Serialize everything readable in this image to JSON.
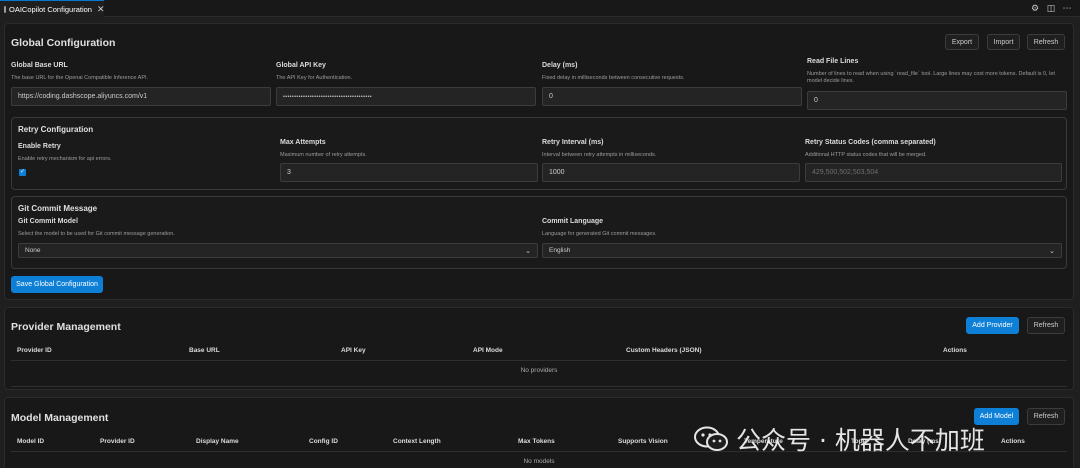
{
  "tab": {
    "title": "OAICopilot Configuration",
    "close": "✕"
  },
  "toolbar_icons": [
    "settings-gear-icon",
    "split-editor-icon",
    "more-icon"
  ],
  "global": {
    "title": "Global Configuration",
    "buttons": {
      "export": "Export",
      "import": "Import",
      "refresh": "Refresh"
    },
    "base_url": {
      "label": "Global Base URL",
      "desc": "The base URL for the Openai Compatible Inference API.",
      "value": "https://coding.dashscope.aliyuncs.com/v1"
    },
    "api_key": {
      "label": "Global API Key",
      "desc": "The API Key for Authentication.",
      "value": "••••••••••••••••••••••••••••••••••••••••"
    },
    "delay": {
      "label": "Delay (ms)",
      "desc": "Fixed delay in milliseconds between consecutive requests.",
      "value": "0"
    },
    "read_file": {
      "label": "Read File Lines",
      "desc": "Number of lines to read when using `read_file` tool. Large lines may cost more tokens. Default is 0, let model decide lines.",
      "value": "0"
    },
    "retry": {
      "title": "Retry Configuration",
      "enable": {
        "label": "Enable Retry",
        "desc": "Enable retry mechanism for api errors.",
        "checked": true
      },
      "max_attempts": {
        "label": "Max Attempts",
        "desc": "Maximum number of retry attempts.",
        "value": "3"
      },
      "interval": {
        "label": "Retry Interval (ms)",
        "desc": "Interval between retry attempts in milliseconds.",
        "value": "1000"
      },
      "status_codes": {
        "label": "Retry Status Codes (comma separated)",
        "desc": "Additional HTTP status codes that will be merged.",
        "placeholder": "429,500,502,503,504"
      }
    },
    "git": {
      "title": "Git Commit Message",
      "model": {
        "label": "Git Commit Model",
        "desc": "Select the model to be used for Git commit message generation.",
        "value": "None"
      },
      "language": {
        "label": "Commit Language",
        "desc": "Language for generated Git commit messages.",
        "value": "English"
      }
    },
    "save": "Save Global Configuration"
  },
  "providers": {
    "title": "Provider Management",
    "add": "Add Provider",
    "refresh": "Refresh",
    "columns": [
      "Provider ID",
      "Base URL",
      "API Key",
      "API Mode",
      "Custom Headers (JSON)",
      "Actions"
    ],
    "empty": "No providers"
  },
  "models": {
    "title": "Model Management",
    "add": "Add Model",
    "refresh": "Refresh",
    "columns": [
      "Model ID",
      "Provider ID",
      "Display Name",
      "Config ID",
      "Context Length",
      "Max Tokens",
      "Supports Vision",
      "Temperature",
      "TopP",
      "Delay (ms)",
      "Actions"
    ],
    "empty": "No models"
  },
  "watermark": {
    "text": "公众号 · 机器人不加班"
  }
}
